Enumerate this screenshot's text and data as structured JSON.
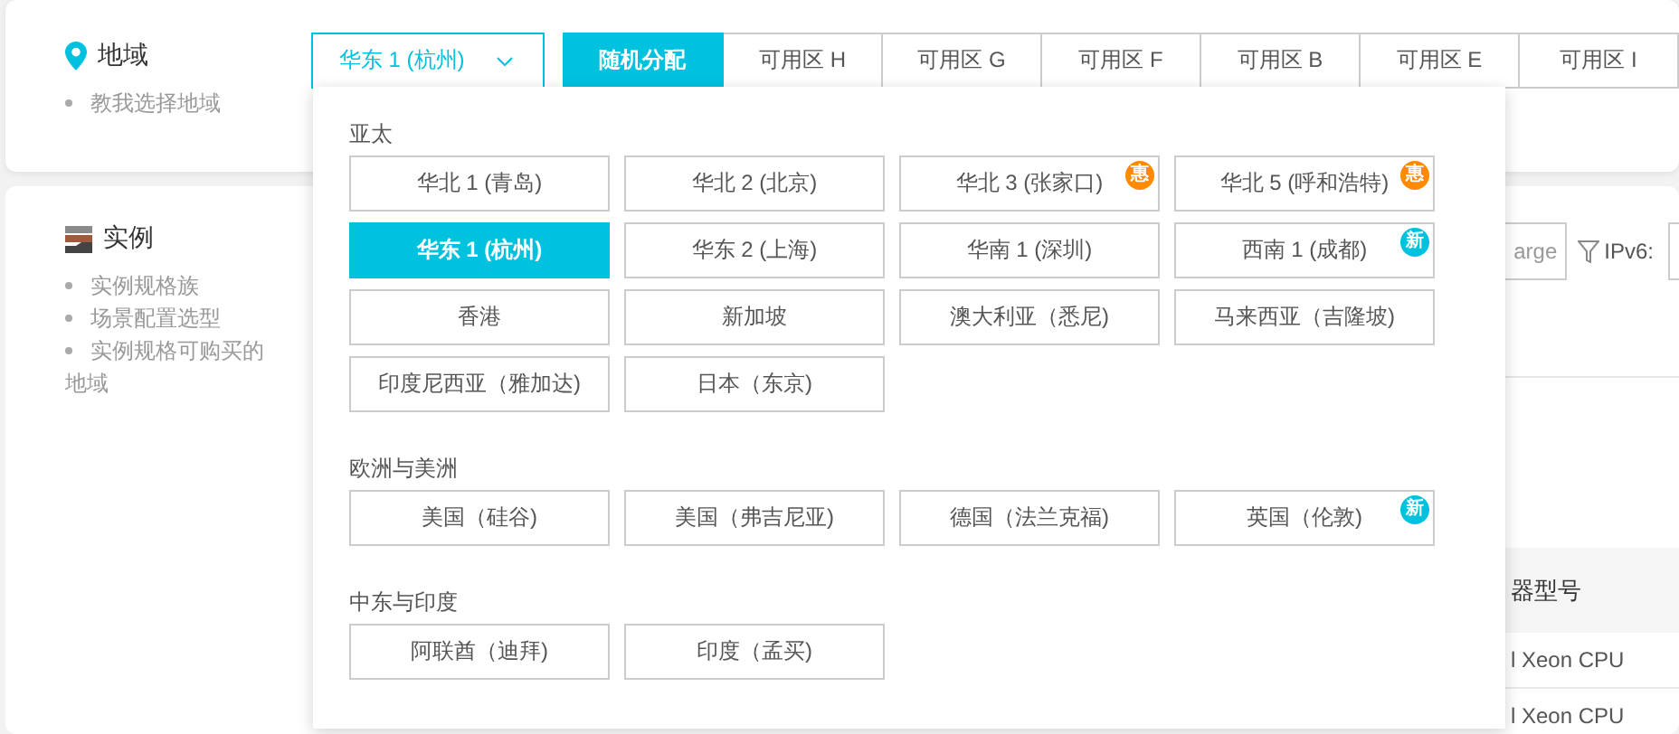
{
  "region": {
    "title": "地域",
    "help_links": [
      "教我选择地域"
    ],
    "selector": {
      "value": "华东 1 (杭州)",
      "expanded": true
    },
    "zones": [
      {
        "label": "随机分配",
        "selected": true
      },
      {
        "label": "可用区 H",
        "selected": false
      },
      {
        "label": "可用区 G",
        "selected": false
      },
      {
        "label": "可用区 F",
        "selected": false
      },
      {
        "label": "可用区 B",
        "selected": false
      },
      {
        "label": "可用区 E",
        "selected": false
      },
      {
        "label": "可用区 I",
        "selected": false
      }
    ]
  },
  "region_dropdown": {
    "groups": [
      {
        "title": "亚太",
        "regions": [
          {
            "label": "华北 1 (青岛)",
            "selected": false
          },
          {
            "label": "华北 2 (北京)",
            "selected": false
          },
          {
            "label": "华北 3 (张家口)",
            "selected": false,
            "badge": {
              "kind": "discount",
              "text": "惠"
            }
          },
          {
            "label": "华北 5 (呼和浩特)",
            "selected": false,
            "badge": {
              "kind": "discount",
              "text": "惠"
            }
          },
          {
            "label": "华东 1 (杭州)",
            "selected": true
          },
          {
            "label": "华东 2 (上海)",
            "selected": false
          },
          {
            "label": "华南 1 (深圳)",
            "selected": false
          },
          {
            "label": "西南 1 (成都)",
            "selected": false,
            "badge": {
              "kind": "new",
              "text": "新"
            }
          },
          {
            "label": "香港",
            "selected": false
          },
          {
            "label": "新加坡",
            "selected": false
          },
          {
            "label": "澳大利亚（悉尼)",
            "selected": false
          },
          {
            "label": "马来西亚（吉隆坡)",
            "selected": false
          },
          {
            "label": "印度尼西亚（雅加达)",
            "selected": false
          },
          {
            "label": "日本（东京)",
            "selected": false
          }
        ]
      },
      {
        "title": "欧洲与美洲",
        "regions": [
          {
            "label": "美国（硅谷)",
            "selected": false
          },
          {
            "label": "美国（弗吉尼亚)",
            "selected": false
          },
          {
            "label": "德国（法兰克福)",
            "selected": false
          },
          {
            "label": "英国（伦敦)",
            "selected": false,
            "badge": {
              "kind": "new",
              "text": "新"
            }
          }
        ]
      },
      {
        "title": "中东与印度",
        "regions": [
          {
            "label": "阿联酋（迪拜)",
            "selected": false
          },
          {
            "label": "印度（孟买)",
            "selected": false
          }
        ]
      }
    ]
  },
  "instance": {
    "title": "实例",
    "help_links": [
      "实例规格族",
      "场景配置选型",
      "实例规格可购买的地域"
    ],
    "filter": {
      "placeholder": "arge"
    },
    "ipv6_label": "IPv6:",
    "table": {
      "columns": [
        "器型号"
      ],
      "rows": [
        [
          "l Xeon CPU"
        ],
        [
          "l Xeon CPU"
        ]
      ]
    }
  }
}
